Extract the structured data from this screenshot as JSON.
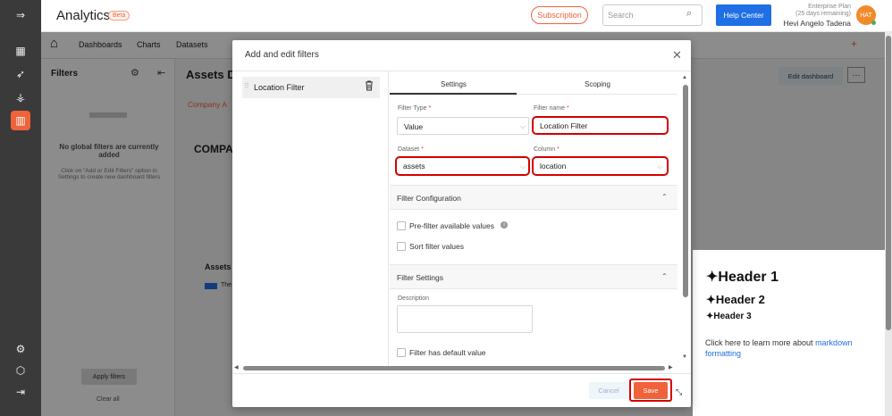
{
  "app": {
    "title": "Analytics",
    "badge": "Beta"
  },
  "topbar": {
    "subscription": "Subscription",
    "search_placeholder": "Search",
    "help": "Help Center",
    "plan_line1": "Enterprise Plan",
    "plan_line2": "(25 days remaining)",
    "user_name": "Hevi Angelo Tadena",
    "avatar_initials": "HAT"
  },
  "nav": {
    "dashboards": "Dashboards",
    "charts": "Charts",
    "datasets": "Datasets",
    "add": "+"
  },
  "filters_panel": {
    "title": "Filters",
    "empty_title": "No global filters are currently added",
    "empty_hint": "Click on \"Add or Edit Filters\" option in Settings to create new dashboard filters",
    "apply": "Apply filters",
    "clear": "Clear all"
  },
  "dashboard": {
    "title": "Assets D",
    "edit": "Edit dashboard",
    "tab": "Company A",
    "compa": "COMPA",
    "assets": "Assets",
    "legend": "The"
  },
  "markdown": {
    "h1": "Header 1",
    "h2": "Header 2",
    "h3": "Header 3",
    "text": "Click here to learn more about ",
    "link": "markdown formatting"
  },
  "modal": {
    "title": "Add and edit filters",
    "filter_item": "Location Filter",
    "tabs": [
      "Settings",
      "Scoping"
    ],
    "filter_type_label": "Filter Type",
    "filter_type_value": "Value",
    "filter_name_label": "Filter name",
    "filter_name_value": "Location Filter",
    "dataset_label": "Dataset",
    "dataset_value": "assets",
    "column_label": "Column",
    "column_value": "location",
    "section_config": "Filter Configuration",
    "prefilter": "Pre-filter available values",
    "sort": "Sort filter values",
    "section_settings": "Filter Settings",
    "description_label": "Description",
    "default_value": "Filter has default value",
    "cancel": "Cancel",
    "save": "Save"
  },
  "colors": {
    "accent": "#f0623a",
    "primary": "#1f6fe5",
    "highlight": "#d40000"
  }
}
